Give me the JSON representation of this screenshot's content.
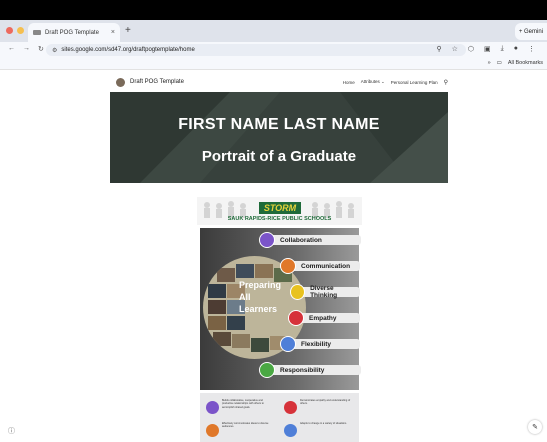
{
  "browser": {
    "tab_title": "Draft POG Template",
    "new_tab": "+",
    "tab_close": "×",
    "gemini_label": "+ Gemini",
    "url": "sites.google.com/sd47.org/draftpogtemplate/home",
    "all_bookmarks": "All Bookmarks",
    "traffic_colors": [
      "#ed6a5e",
      "#f5bf4f",
      "#61c554"
    ]
  },
  "site": {
    "title": "Draft POG Template",
    "nav": [
      "Home",
      "Attributes ⌄",
      "Personal Learning Plan"
    ],
    "banner_name": "FIRST NAME LAST NAME",
    "banner_subtitle": "Portrait of a Graduate",
    "banner_color": "#37413c"
  },
  "poster": {
    "logo_text": "STORM",
    "school": "SAUK RAPIDS-RICE PUBLIC SCHOOLS",
    "center_text": [
      "Preparing",
      "All",
      "Learners"
    ],
    "traits": [
      {
        "label": "Collaboration",
        "color": "#7b54c9"
      },
      {
        "label": "Communication",
        "color": "#e0782a"
      },
      {
        "label": "Diverse Thinking",
        "color": "#e8c21f"
      },
      {
        "label": "Empathy",
        "color": "#d6323a"
      },
      {
        "label": "Flexibility",
        "color": "#4f7fd8"
      },
      {
        "label": "Responsibility",
        "color": "#4aa843"
      }
    ],
    "bottom_items": [
      {
        "color": "#7b54c9",
        "text": "Builds collaborative, cooperative and productive relationships with others to accomplish shared goals."
      },
      {
        "color": "#d6323a",
        "text": "Demonstrates empathy and understanding of others."
      },
      {
        "color": "#e0782a",
        "text": "Effectively communicates ideas to diverse audiences."
      },
      {
        "color": "#4f7fd8",
        "text": "Adapts to change in a variety of situations."
      }
    ]
  }
}
